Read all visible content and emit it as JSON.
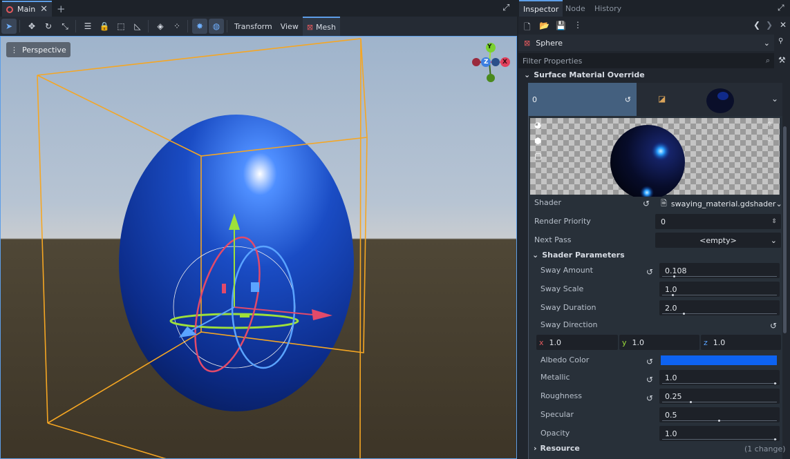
{
  "editor": {
    "scene_tab": "Main",
    "add_tab_icon": "plus-icon",
    "maximize_icon": "fullscreen-icon"
  },
  "toolbar": {
    "transform_menu": "Transform",
    "view_menu": "View",
    "mesh_menu": "Mesh"
  },
  "viewport": {
    "perspective_label": "Perspective",
    "gizmo": {
      "y": "Y",
      "z": "Z",
      "x": "X"
    },
    "colors": {
      "sphere": "#1e4fc0",
      "selection_box": "#f5a623"
    }
  },
  "dock": {
    "tabs": [
      "Inspector",
      "Node",
      "History"
    ],
    "resource_name": "Sphere",
    "filter_placeholder": "Filter Properties",
    "section_title": "Surface Material Override",
    "surface_slot": "0",
    "properties": {
      "shader_label": "Shader",
      "shader_value": "swaying_material.gdshader",
      "render_priority_label": "Render Priority",
      "render_priority_value": "0",
      "next_pass_label": "Next Pass",
      "next_pass_value": "<empty>"
    },
    "shader_params": {
      "title": "Shader Parameters",
      "sway_amount_label": "Sway Amount",
      "sway_amount": "0.108",
      "sway_scale_label": "Sway Scale",
      "sway_scale": "1.0",
      "sway_duration_label": "Sway Duration",
      "sway_duration": "2.0",
      "sway_direction_label": "Sway Direction",
      "dir_x_label": "x",
      "dir_x": "1.0",
      "dir_y_label": "y",
      "dir_y": "1.0",
      "dir_z_label": "z",
      "dir_z": "1.0",
      "albedo_label": "Albedo Color",
      "albedo_color": "#0d63f2",
      "metallic_label": "Metallic",
      "metallic": "1.0",
      "roughness_label": "Roughness",
      "roughness": "0.25",
      "specular_label": "Specular",
      "specular": "0.5",
      "opacity_label": "Opacity",
      "opacity": "1.0"
    },
    "resource_section": "Resource",
    "changes": "(1 change)"
  }
}
